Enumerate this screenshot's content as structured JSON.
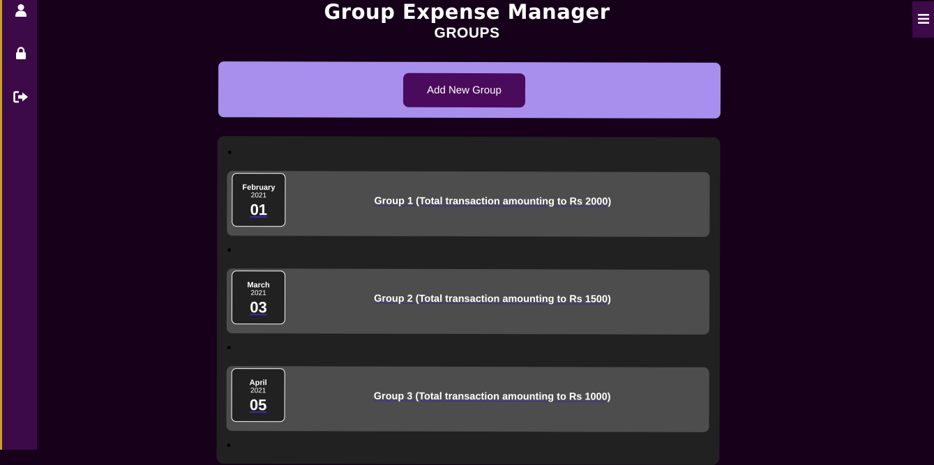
{
  "header": {
    "app_title": "Group Expense Manager",
    "section_title": "GROUPS"
  },
  "sidebar": {
    "items": [
      {
        "icon": "user-icon"
      },
      {
        "icon": "lock-icon"
      },
      {
        "icon": "logout-icon"
      }
    ]
  },
  "menu": {
    "icon": "hamburger-menu-icon"
  },
  "add_panel": {
    "button_label": "Add New Group"
  },
  "groups": [
    {
      "month": "February",
      "year": "2021",
      "day": "01",
      "title": "Group 1 (Total transaction amounting to Rs 2000)"
    },
    {
      "month": "March",
      "year": "2021",
      "day": "03",
      "title": "Group 2 (Total transaction amounting to Rs 1500)"
    },
    {
      "month": "April",
      "year": "2021",
      "day": "05",
      "title": "Group 3 (Total transaction amounting to Rs 1000)"
    }
  ],
  "colors": {
    "background": "#16001a",
    "sidebar": "#3d0a48",
    "sidebar_edge": "#c9a227",
    "panel_purple": "#a88fed",
    "button": "#4b0b5c",
    "list_panel": "#212121",
    "card": "#4d4d4d"
  }
}
